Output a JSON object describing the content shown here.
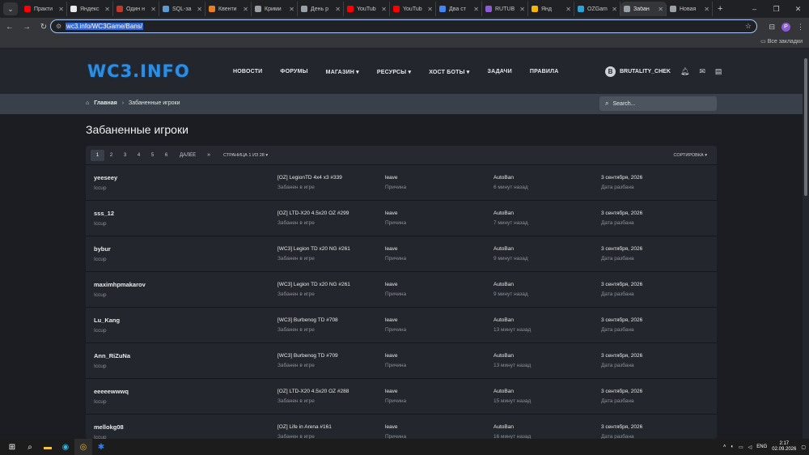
{
  "browser": {
    "tabs": [
      {
        "title": "Практи",
        "color": "#ff0000"
      },
      {
        "title": "Яндекс",
        "color": "#e8eaed"
      },
      {
        "title": "Один н",
        "color": "#c0392b"
      },
      {
        "title": "SQL-за",
        "color": "#5b9bd5"
      },
      {
        "title": "Квенти",
        "color": "#e67e22"
      },
      {
        "title": "Крими",
        "color": "#9aa0a6"
      },
      {
        "title": "День р",
        "color": "#9aa0a6"
      },
      {
        "title": "YouTub",
        "color": "#ff0000"
      },
      {
        "title": "YouTub",
        "color": "#ff0000"
      },
      {
        "title": "Два ст",
        "color": "#4285f4"
      },
      {
        "title": "RUTUB",
        "color": "#8e5bd8"
      },
      {
        "title": "Янд",
        "color": "#f4b400"
      },
      {
        "title": "OZGam",
        "color": "#2aa3d8"
      },
      {
        "title": "Забан",
        "color": "#9aa0a6"
      },
      {
        "title": "Новая",
        "color": "#9aa0a6"
      }
    ],
    "url": "wc3.info/WC3Game/Bans/",
    "bookmarks_all": "Все закладки",
    "profile_letter": "P"
  },
  "site": {
    "logo": "WC3.INFO",
    "nav": [
      "НОВОСТИ",
      "ФОРУМЫ",
      "МАГАЗИН ▾",
      "РЕСУРСЫ ▾",
      "ХОСТ БОТЫ ▾",
      "ЗАДАЧИ",
      "ПРАВИЛА"
    ],
    "user": {
      "initial": "B",
      "name": "BRUTALITY_CHEK"
    },
    "breadcrumb": {
      "home": "Главная",
      "current": "Забаненные игроки"
    },
    "search_placeholder": "Search...",
    "page_title": "Забаненные игроки"
  },
  "pager": {
    "pages": [
      "1",
      "2",
      "3",
      "4",
      "5",
      "6"
    ],
    "next": "ДАЛЕЕ",
    "last": "»",
    "info": "СТРАНИЦА 1 ИЗ 28 ▾",
    "sort": "СОРТИРОВКА ▾"
  },
  "bans": [
    {
      "player": "yeeseey",
      "realm": "Iccup",
      "game": "[OZ] LegionTD 4x4 x3 #339",
      "game_label": "Забанен в игре",
      "reason": "leave",
      "reason_label": "Причина",
      "by": "AutoBan",
      "ago": "6 минут назад",
      "date": "3 сентября, 2026",
      "date_label": "Дата разбана"
    },
    {
      "player": "sss_12",
      "realm": "Iccup",
      "game": "[OZ] LTD-X20 4.5x20 OZ #299",
      "game_label": "Забанен в игре",
      "reason": "leave",
      "reason_label": "Причина",
      "by": "AutoBan",
      "ago": "7 минут назад",
      "date": "3 сентября, 2026",
      "date_label": "Дата разбана"
    },
    {
      "player": "bybur",
      "realm": "Iccup",
      "game": "[WC3] Legion TD x20 NG #261",
      "game_label": "Забанен в игре",
      "reason": "leave",
      "reason_label": "Причина",
      "by": "AutoBan",
      "ago": "9 минут назад",
      "date": "3 сентября, 2026",
      "date_label": "Дата разбана"
    },
    {
      "player": "maximhpmakarov",
      "realm": "Iccup",
      "game": "[WC3] Legion TD x20 NG #261",
      "game_label": "Забанен в игре",
      "reason": "leave",
      "reason_label": "Причина",
      "by": "AutoBan",
      "ago": "9 минут назад",
      "date": "3 сентября, 2026",
      "date_label": "Дата разбана"
    },
    {
      "player": "Lu_Kang",
      "realm": "Iccup",
      "game": "[WC3] Burbenog TD #708",
      "game_label": "Забанен в игре",
      "reason": "leave",
      "reason_label": "Причина",
      "by": "AutoBan",
      "ago": "13 минут назад",
      "date": "3 сентября, 2026",
      "date_label": "Дата разбана"
    },
    {
      "player": "Ann_RiZuNa",
      "realm": "Iccup",
      "game": "[WC3] Burbenog TD #709",
      "game_label": "Забанен в игре",
      "reason": "leave",
      "reason_label": "Причина",
      "by": "AutoBan",
      "ago": "13 минут назад",
      "date": "3 сентября, 2026",
      "date_label": "Дата разбана"
    },
    {
      "player": "eeeeewwwq",
      "realm": "Iccup",
      "game": "[OZ] LTD-X20 4.5x20 OZ #288",
      "game_label": "Забанен в игре",
      "reason": "leave",
      "reason_label": "Причина",
      "by": "AutoBan",
      "ago": "15 минут назад",
      "date": "3 сентября, 2026",
      "date_label": "Дата разбана"
    },
    {
      "player": "mellokg08",
      "realm": "Iccup",
      "game": "[OZ] Life in Arena #161",
      "game_label": "Забанен в игре",
      "reason": "leave",
      "reason_label": "Причина",
      "by": "AutoBan",
      "ago": "16 минут назад",
      "date": "3 сентября, 2026",
      "date_label": "Дата разбана"
    }
  ],
  "taskbar": {
    "lang": "ENG",
    "time": "2:17",
    "date": "02.09.2026"
  }
}
